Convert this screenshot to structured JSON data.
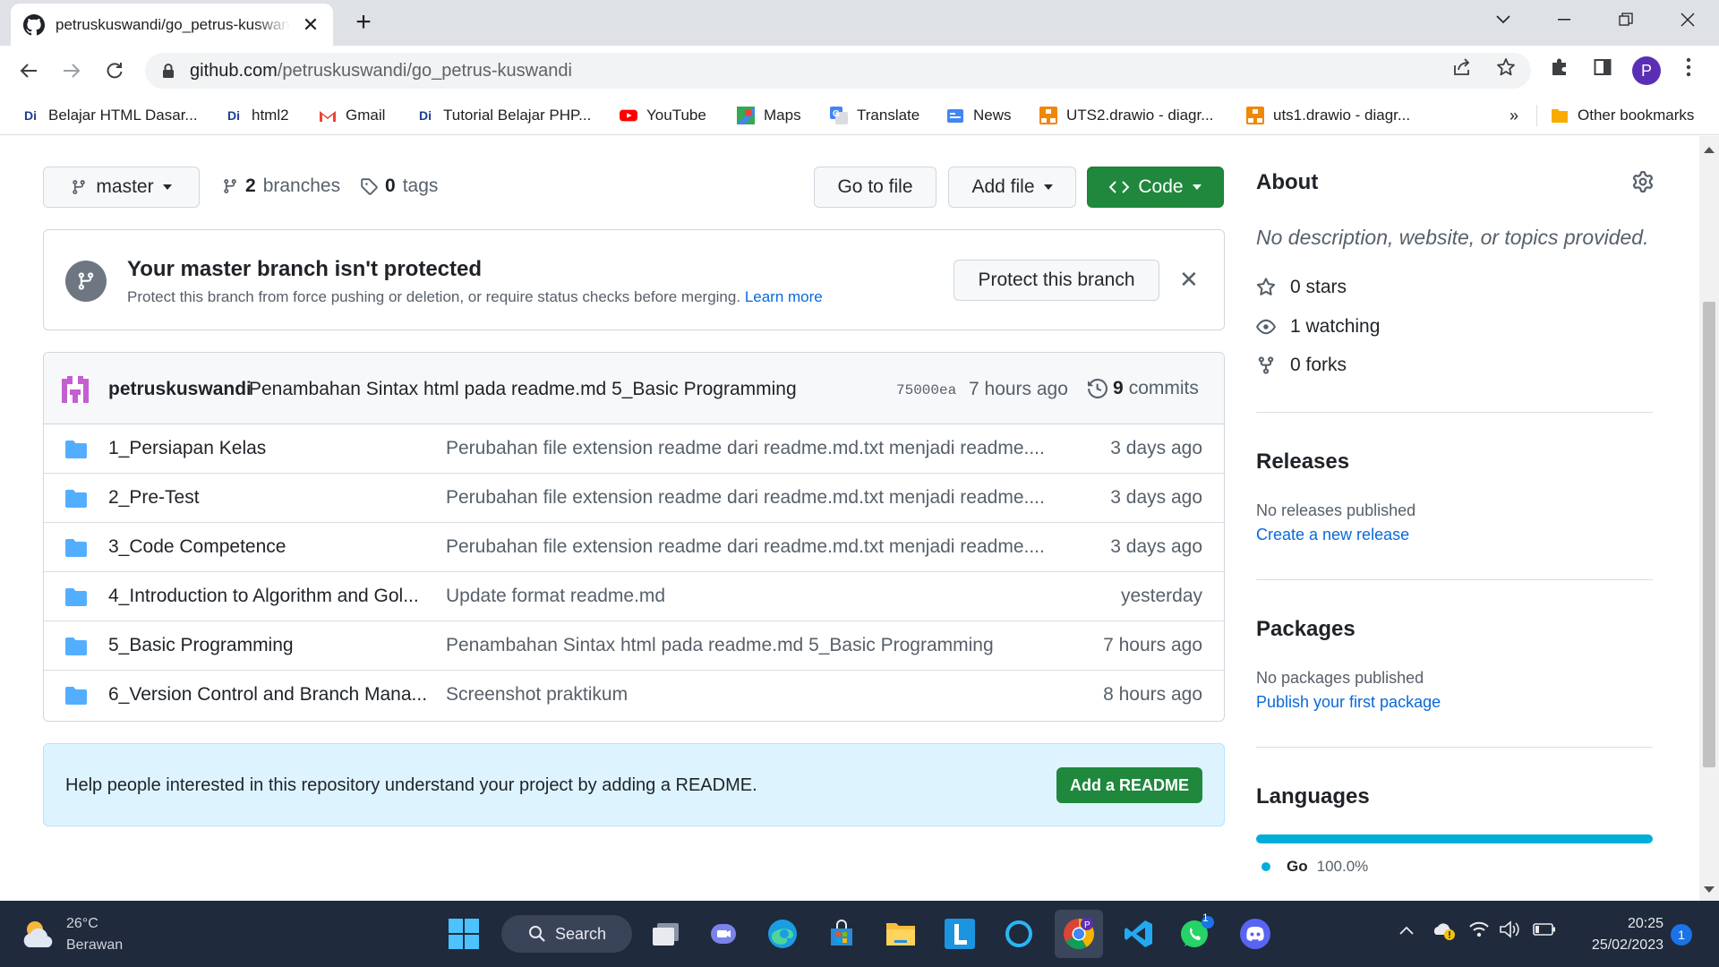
{
  "browser": {
    "tab_title": "petruskuswandi/go_petrus-kuswandi",
    "url_host": "github.com",
    "url_path": "/petruskuswandi/go_petrus-kuswandi",
    "profile_initial": "P",
    "bookmarks": [
      {
        "label": "Belajar HTML Dasar...",
        "icon": "di-icon"
      },
      {
        "label": "html2",
        "icon": "di-icon"
      },
      {
        "label": "Gmail",
        "icon": "gmail-icon"
      },
      {
        "label": "Tutorial Belajar PHP...",
        "icon": "di-icon"
      },
      {
        "label": "YouTube",
        "icon": "youtube-icon"
      },
      {
        "label": "Maps",
        "icon": "maps-icon"
      },
      {
        "label": "Translate",
        "icon": "translate-icon"
      },
      {
        "label": "News",
        "icon": "news-icon"
      },
      {
        "label": "UTS2.drawio - diagr...",
        "icon": "drawio-icon"
      },
      {
        "label": "uts1.drawio - diagr...",
        "icon": "drawio-icon"
      }
    ],
    "overflow_label": "»",
    "other_bookmarks": "Other bookmarks"
  },
  "repo": {
    "branch_button": "master",
    "branches_count": "2",
    "branches_label": "branches",
    "tags_count": "0",
    "tags_label": "tags",
    "go_to_file": "Go to file",
    "add_file": "Add file",
    "code": "Code",
    "banner": {
      "title": "Your master branch isn't protected",
      "text": "Protect this branch from force pushing or deletion, or require status checks before merging.",
      "learn_more": "Learn more",
      "protect_button": "Protect this branch",
      "close": "✕"
    },
    "latest_commit": {
      "author": "petruskuswandi",
      "message": "Penambahan Sintax html pada readme.md 5_Basic Programming",
      "sha": "75000ea",
      "time": "7 hours ago",
      "commits_count": "9",
      "commits_label": "commits"
    },
    "files": [
      {
        "name": "1_Persiapan Kelas",
        "message": "Perubahan file extension readme dari readme.md.txt menjadi readme....",
        "date": "3 days ago"
      },
      {
        "name": "2_Pre-Test",
        "message": "Perubahan file extension readme dari readme.md.txt menjadi readme....",
        "date": "3 days ago"
      },
      {
        "name": "3_Code Competence",
        "message": "Perubahan file extension readme dari readme.md.txt menjadi readme....",
        "date": "3 days ago"
      },
      {
        "name": "4_Introduction to Algorithm and Gol...",
        "message": "Update format readme.md",
        "date": "yesterday"
      },
      {
        "name": "5_Basic Programming",
        "message": "Penambahan Sintax html pada readme.md 5_Basic Programming",
        "date": "7 hours ago"
      },
      {
        "name": "6_Version Control and Branch Mana...",
        "message": "Screenshot praktikum",
        "date": "8 hours ago"
      }
    ],
    "readme_prompt": "Help people interested in this repository understand your project by adding a README.",
    "add_readme": "Add a README"
  },
  "sidebar": {
    "about_title": "About",
    "about_desc": "No description, website, or topics provided.",
    "stars": "0 stars",
    "watching": "1 watching",
    "forks": "0 forks",
    "releases_title": "Releases",
    "releases_text": "No releases published",
    "releases_link": "Create a new release",
    "packages_title": "Packages",
    "packages_text": "No packages published",
    "packages_link": "Publish your first package",
    "languages_title": "Languages",
    "language_name": "Go",
    "language_pct": "100.0%",
    "language_color": "#00add8"
  },
  "taskbar": {
    "temperature": "26°C",
    "weather": "Berawan",
    "search_label": "Search",
    "time": "20:25",
    "date": "25/02/2023",
    "notification_count": "1",
    "whatsapp_badge": "1"
  }
}
